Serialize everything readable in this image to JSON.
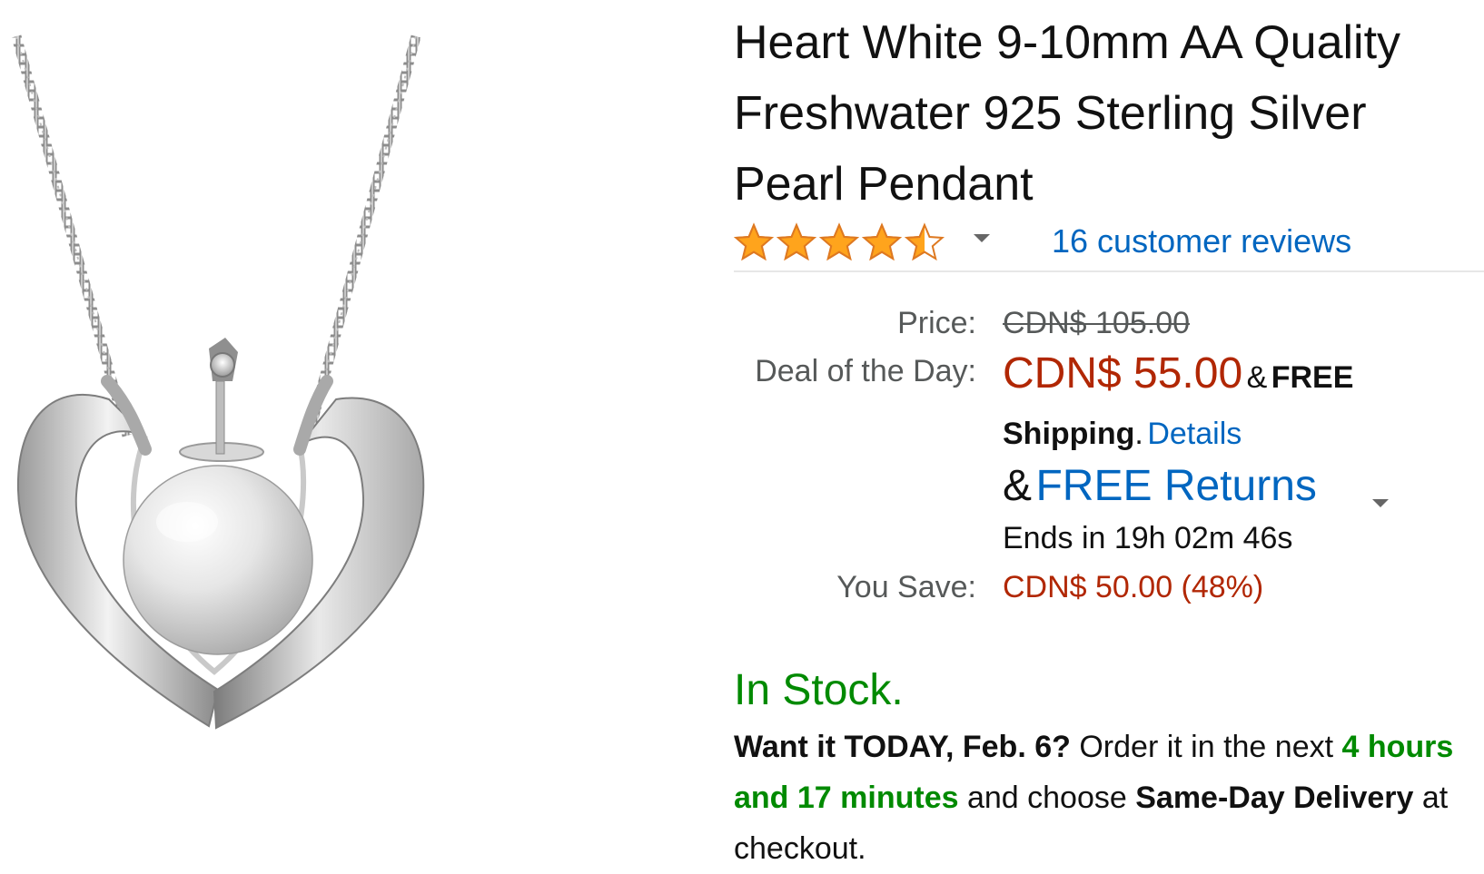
{
  "product": {
    "title": "Heart White 9-10mm AA Quality Freshwater 925 Sterling Silver Pearl Pendant",
    "image_icon": "pearl-heart-pendant-image"
  },
  "rating": {
    "stars": 4.5,
    "max_stars": 5,
    "reviews_link": "16 customer reviews",
    "star_color": "#ffa41c",
    "star_outline": "#de7921"
  },
  "pricing": {
    "price_label": "Price:",
    "list_price": "CDN$ 105.00",
    "deal_label": "Deal of the Day:",
    "deal_price": "CDN$ 55.00",
    "shipping_prefix": "&",
    "shipping_bold": "FREE Shipping",
    "shipping_period": ".",
    "details_link": "Details",
    "returns_prefix": "&",
    "returns_link": "FREE Returns",
    "ends_text": "Ends in 19h 02m 46s",
    "save_label": "You Save:",
    "save_value": "CDN$ 50.00 (48%)"
  },
  "availability": {
    "status": "In Stock.",
    "delivery": {
      "lead_bold": "Want it TODAY, Feb. 6?",
      "order_text": "Order it in the next",
      "time_left": "4 hours and 17 minutes",
      "choose_text": "and choose",
      "method_bold": "Same-Day Delivery",
      "end_text": "at checkout."
    }
  },
  "colors": {
    "link": "#0066c0",
    "price_red": "#b12704",
    "stock_green": "#008a00",
    "label_gray": "#565959"
  }
}
